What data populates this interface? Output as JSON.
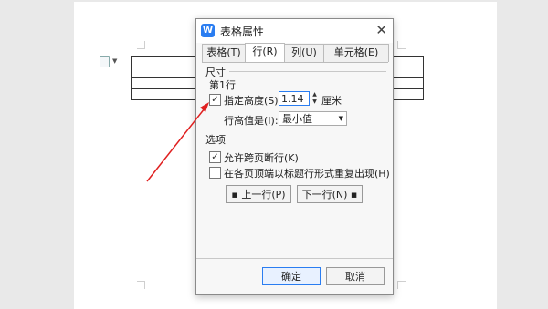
{
  "dialog": {
    "title": "表格属性",
    "logo_letter": "W",
    "tabs": [
      {
        "label": "表格(T)"
      },
      {
        "label": "行(R)"
      },
      {
        "label": "列(U)"
      },
      {
        "label": "单元格(E)"
      }
    ],
    "size_section": "尺寸",
    "row_label": "第1行",
    "specify_height_label": "指定高度(S):",
    "specify_height_checked": true,
    "height_value": "1.14",
    "height_unit": "厘米",
    "row_height_is_label": "行高值是(I):",
    "row_height_mode": "最小值",
    "options_section": "选项",
    "allow_break_label": "允许跨页断行(K)",
    "allow_break_checked": true,
    "repeat_header_label": "在各页顶端以标题行形式重复出现(H)",
    "repeat_header_checked": false,
    "prev_row": "上一行(P)",
    "next_row": "下一行(N)",
    "ok": "确定",
    "cancel": "取消"
  },
  "colors": {
    "accent": "#2a7df1",
    "arrow": "#e02020"
  }
}
